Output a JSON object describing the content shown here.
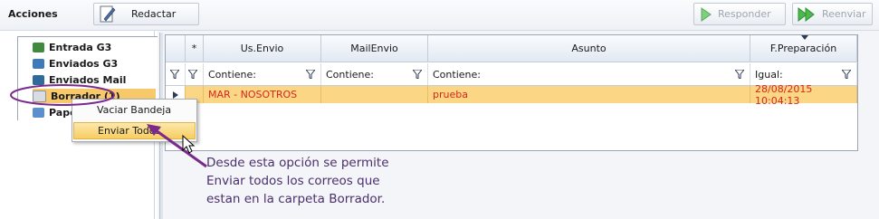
{
  "toolbar": {
    "title": "Acciones",
    "redactar": "Redactar",
    "responder": "Responder",
    "reenviar": "Reenviar"
  },
  "tree": {
    "items": [
      {
        "label": "Entrada G3",
        "icon": "inbox-icon"
      },
      {
        "label": "Enviados G3",
        "icon": "sent-icon"
      },
      {
        "label": "Enviados Mail",
        "icon": "sent-mail-icon"
      },
      {
        "label": "Borrador (1)",
        "icon": "drafts-icon"
      },
      {
        "label": "Papelera",
        "icon": "trash-icon"
      }
    ]
  },
  "context_menu": {
    "items": [
      "Vaciar Bandeja",
      "Enviar Todos"
    ]
  },
  "grid": {
    "columns": [
      "",
      "*",
      "Us.Envio",
      "MailEnvio",
      "Asunto",
      "F.Preparación"
    ],
    "filters": [
      "Contiene:",
      "Contiene:",
      "Contiene:",
      "Igual:"
    ],
    "rows": [
      {
        "us_envio": "MAR - NOSOTROS",
        "mail_envio": "",
        "asunto": "prueba",
        "fecha": "28/08/2015 10:04:13"
      }
    ]
  },
  "annotation": {
    "lines": [
      "Desde esta opción se permite",
      "Enviar todos los correos  que",
      "estan en la carpeta Borrador."
    ]
  },
  "colors": {
    "selection": "#fbd685",
    "row_text": "#d6281b",
    "annotation": "#7a2a8c"
  }
}
